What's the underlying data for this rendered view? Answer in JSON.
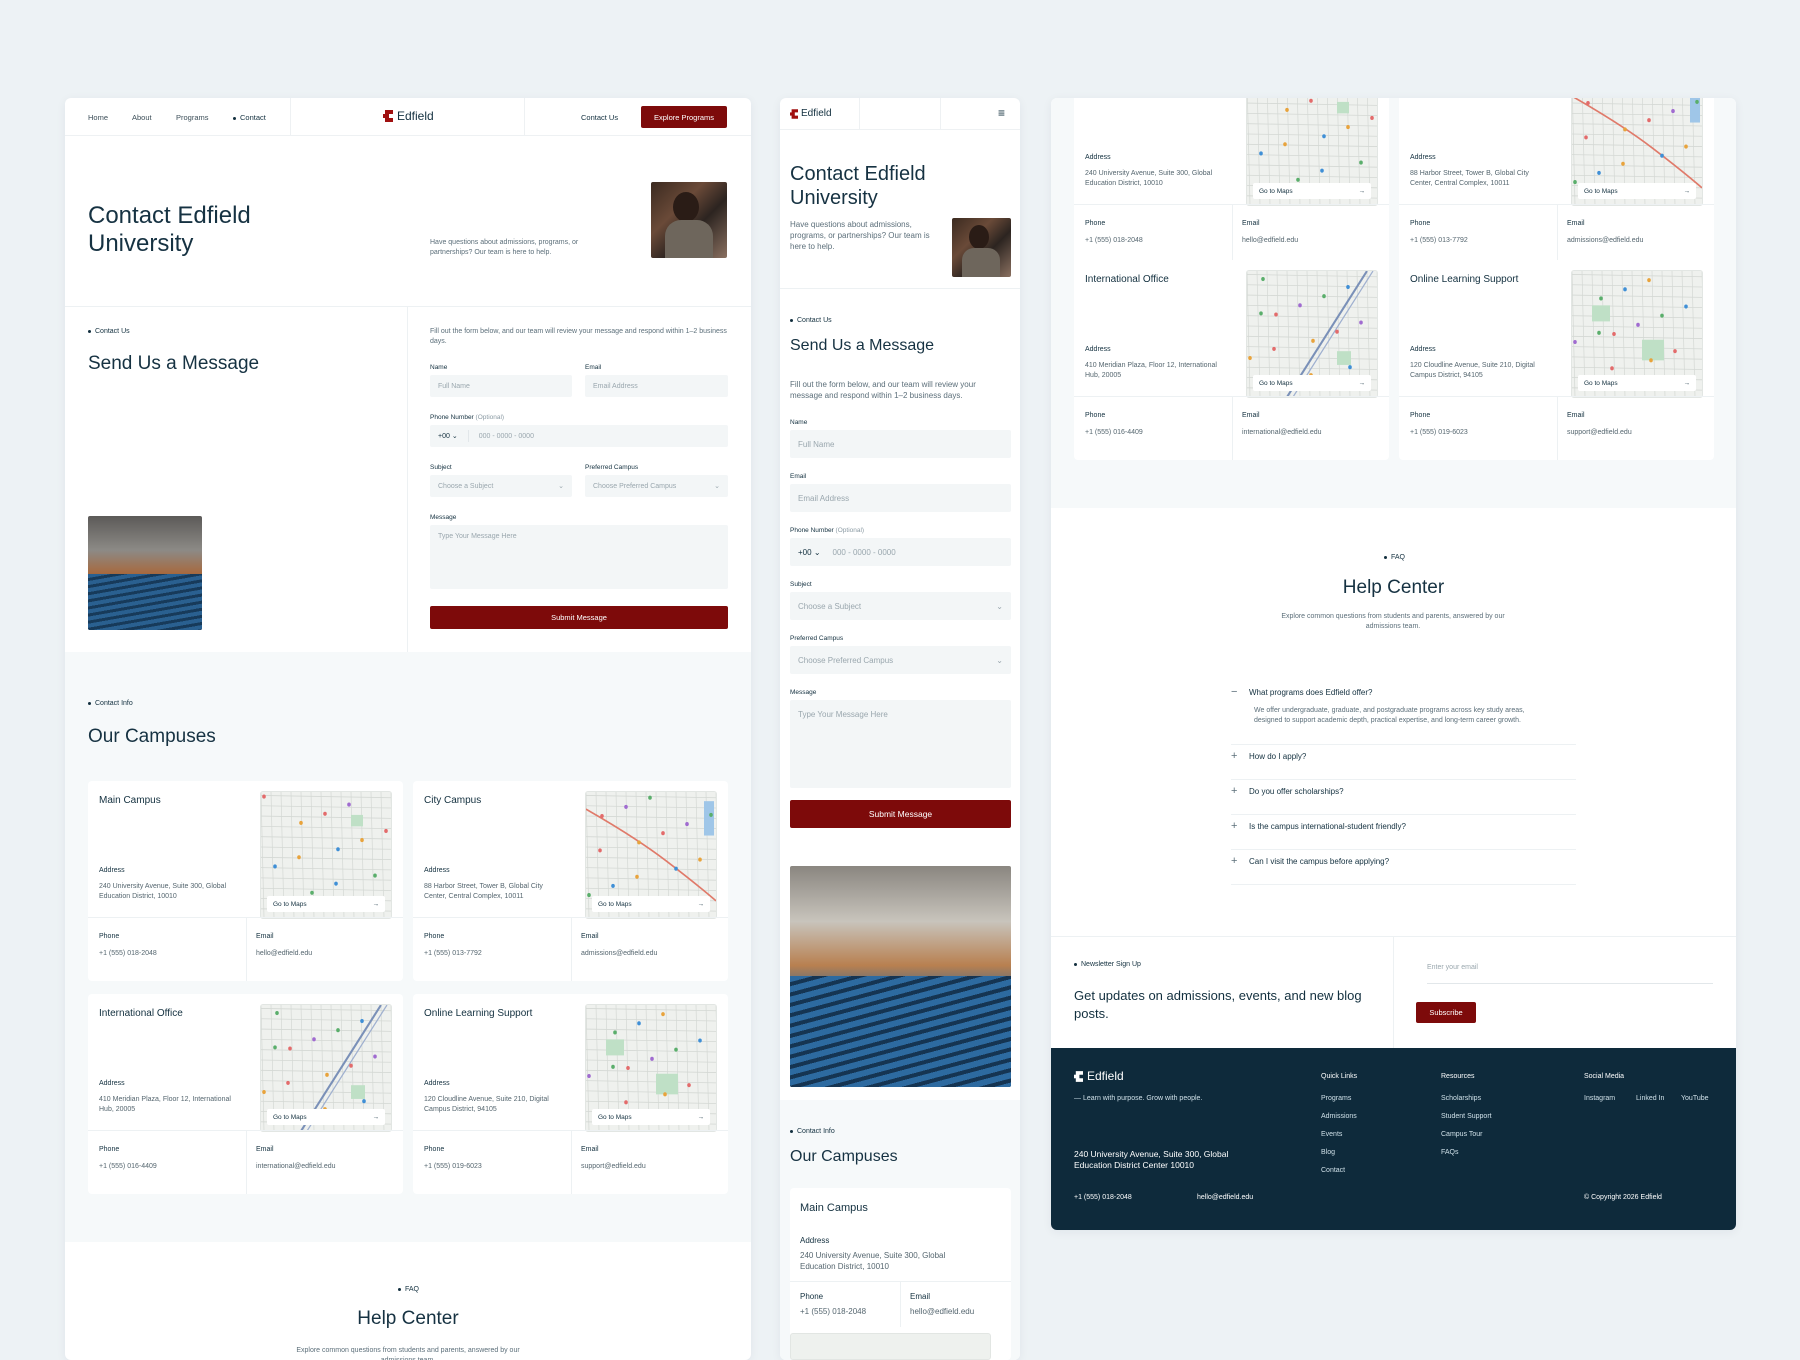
{
  "brand": {
    "name": "Edfield",
    "accent": "#7d0a0a",
    "navy": "#0e2a3b"
  },
  "desktop": {
    "nav": [
      "Home",
      "About",
      "Programs",
      "Contact"
    ],
    "nav_contact_label": "Contact Us",
    "nav_cta": "Explore Programs",
    "hero_title_l1": "Contact Edfield",
    "hero_title_l2": "University",
    "hero_text": "Have questions about admissions, programs, or partnerships? Our team is here to help.",
    "contact_eyebrow": "Contact Us",
    "contact_title": "Send Us a Message",
    "form_intro": "Fill out the form below, and our team will review your message and respond within 1–2 business days."
  },
  "form": {
    "name_label": "Name",
    "name_ph": "Full Name",
    "email_label": "Email",
    "email_ph": "Email Address",
    "phone_label": "Phone Number",
    "phone_optional": "(Optional)",
    "phone_code": "+00",
    "phone_ph": "000 - 0000 - 0000",
    "subject_label": "Subject",
    "subject_ph": "Choose a Subject",
    "campus_label": "Preferred Campus",
    "campus_ph": "Choose Preferred Campus",
    "message_label": "Message",
    "message_ph": "Type Your Message Here",
    "submit": "Submit Message"
  },
  "campuses": {
    "eyebrow": "Contact Info",
    "title": "Our Campuses",
    "address_label": "Address",
    "phone_label": "Phone",
    "email_label": "Email",
    "maps_label": "Go to Maps",
    "items": [
      {
        "name": "Main Campus",
        "address": "240 University Avenue, Suite 300, Global Education District, 10010",
        "phone": "+1 (555) 018-2048",
        "email": "hello@edfield.edu"
      },
      {
        "name": "City Campus",
        "address": "88 Harbor Street, Tower B, Global City Center, Central Complex, 10011",
        "phone": "+1 (555) 013-7792",
        "email": "admissions@edfield.edu"
      },
      {
        "name": "International Office",
        "address": "410 Meridian Plaza, Floor 12, International Hub, 20005",
        "phone": "+1 (555) 016-4409",
        "email": "international@edfield.edu"
      },
      {
        "name": "Online Learning Support",
        "address": "120 Cloudline Avenue, Suite 210, Digital Campus District, 94105",
        "phone": "+1 (555) 019-6023",
        "email": "support@edfield.edu"
      }
    ]
  },
  "faq": {
    "eyebrow": "FAQ",
    "title": "Help Center",
    "subtitle": "Explore common questions from students and parents, answered by our admissions team.",
    "items": [
      {
        "q": "What programs does Edfield offer?",
        "a": "We offer undergraduate, graduate, and postgraduate programs across key study areas, designed to support academic depth, practical expertise, and long-term career growth."
      },
      {
        "q": "How do I apply?"
      },
      {
        "q": "Do you offer scholarships?"
      },
      {
        "q": "Is the campus international-student friendly?"
      },
      {
        "q": "Can I visit the campus before applying?"
      }
    ]
  },
  "mobile": {
    "title_l1": "Contact Edfield",
    "title_l2": "University",
    "intro": "Have questions about admissions, programs, or partnerships? Our team is here to help.",
    "campus_address": "240 University Avenue, Suite 300, Global Education District, 10010"
  },
  "newsletter": {
    "eyebrow": "Newsletter Sign Up",
    "text": "Get updates on admissions, events, and new blog posts.",
    "email_ph": "Enter your email",
    "button": "Subscribe"
  },
  "footer": {
    "tagline": "— Learn with purpose. Grow with people.",
    "address": "240 University Avenue, Suite 300, Global Education District Center 10010",
    "phone": "+1 (555) 018-2048",
    "email": "hello@edfield.edu",
    "quick_title": "Quick Links",
    "quick": [
      "Programs",
      "Admissions",
      "Events",
      "Blog",
      "Contact"
    ],
    "res_title": "Resources",
    "resources": [
      "Scholarships",
      "Student Support",
      "Campus Tour",
      "FAQs"
    ],
    "social_title": "Social Media",
    "social": [
      "Instagram",
      "Linked In",
      "YouTube"
    ],
    "copyright": "© Copyright 2026 Edfield"
  }
}
